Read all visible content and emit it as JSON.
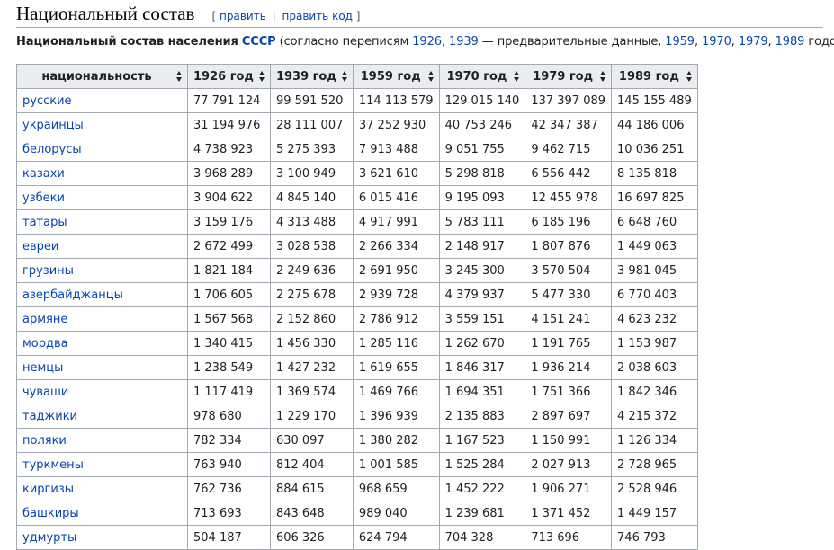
{
  "section": {
    "title": "Национальный состав",
    "edit_open": "[",
    "edit_label": "править",
    "edit_sep": "|",
    "edit_code_label": "править код",
    "edit_close": "]"
  },
  "caption": {
    "bold_text": "Национальный состав населения",
    "country_link": "СССР",
    "text_1": "(согласно переписям",
    "link_1926": "1926",
    "comma_1": ",",
    "link_1939": "1939",
    "text_2": "— предварительные данные,",
    "link_1959": "1959",
    "comma_2": ",",
    "link_1970": "1970",
    "comma_3": ",",
    "link_1979": "1979",
    "comma_4": ",",
    "link_1989": "1989",
    "text_3": "годов)"
  },
  "table": {
    "headers": [
      "национальность",
      "1926 год",
      "1939 год",
      "1959 год",
      "1970 год",
      "1979 год",
      "1989 год"
    ],
    "rows": [
      {
        "name": "русские",
        "values": [
          "77 791 124",
          "99 591 520",
          "114 113 579",
          "129 015 140",
          "137 397 089",
          "145 155 489"
        ]
      },
      {
        "name": "украинцы",
        "values": [
          "31 194 976",
          "28 111 007",
          "37 252 930",
          "40 753 246",
          "42 347 387",
          "44 186 006"
        ]
      },
      {
        "name": "белорусы",
        "values": [
          "4 738 923",
          "5 275 393",
          "7 913 488",
          "9 051 755",
          "9 462 715",
          "10 036 251"
        ]
      },
      {
        "name": "казахи",
        "values": [
          "3 968 289",
          "3 100 949",
          "3 621 610",
          "5 298 818",
          "6 556 442",
          "8 135 818"
        ]
      },
      {
        "name": "узбеки",
        "values": [
          "3 904 622",
          "4 845 140",
          "6 015 416",
          "9 195 093",
          "12 455 978",
          "16 697 825"
        ]
      },
      {
        "name": "татары",
        "values": [
          "3 159 176",
          "4 313 488",
          "4 917 991",
          "5 783 111",
          "6 185 196",
          "6 648 760"
        ]
      },
      {
        "name": "евреи",
        "values": [
          "2 672 499",
          "3 028 538",
          "2 266 334",
          "2 148 917",
          "1 807 876",
          "1 449 063"
        ]
      },
      {
        "name": "грузины",
        "values": [
          "1 821 184",
          "2 249 636",
          "2 691 950",
          "3 245 300",
          "3 570 504",
          "3 981 045"
        ]
      },
      {
        "name": "азербайджанцы",
        "values": [
          "1 706 605",
          "2 275 678",
          "2 939 728",
          "4 379 937",
          "5 477 330",
          "6 770 403"
        ]
      },
      {
        "name": "армяне",
        "values": [
          "1 567 568",
          "2 152 860",
          "2 786 912",
          "3 559 151",
          "4 151 241",
          "4 623 232"
        ]
      },
      {
        "name": "мордва",
        "values": [
          "1 340 415",
          "1 456 330",
          "1 285 116",
          "1 262 670",
          "1 191 765",
          "1 153 987"
        ]
      },
      {
        "name": "немцы",
        "values": [
          "1 238 549",
          "1 427 232",
          "1 619 655",
          "1 846 317",
          "1 936 214",
          "2 038 603"
        ]
      },
      {
        "name": "чуваши",
        "values": [
          "1 117 419",
          "1 369 574",
          "1 469 766",
          "1 694 351",
          "1 751 366",
          "1 842 346"
        ]
      },
      {
        "name": "таджики",
        "values": [
          "978 680",
          "1 229 170",
          "1 396 939",
          "2 135 883",
          "2 897 697",
          "4 215 372"
        ]
      },
      {
        "name": "поляки",
        "values": [
          "782 334",
          "630 097",
          "1 380 282",
          "1 167 523",
          "1 150 991",
          "1 126 334"
        ]
      },
      {
        "name": "туркмены",
        "values": [
          "763 940",
          "812 404",
          "1 001 585",
          "1 525 284",
          "2 027 913",
          "2 728 965"
        ]
      },
      {
        "name": "киргизы",
        "values": [
          "762 736",
          "884 615",
          "968 659",
          "1 452 222",
          "1 906 271",
          "2 528 946"
        ]
      },
      {
        "name": "башкиры",
        "values": [
          "713 693",
          "843 648",
          "989 040",
          "1 239 681",
          "1 371 452",
          "1 449 157"
        ]
      },
      {
        "name": "удмурты",
        "values": [
          "504 187",
          "606 326",
          "624 794",
          "704 328",
          "713 696",
          "746 793"
        ]
      }
    ]
  }
}
